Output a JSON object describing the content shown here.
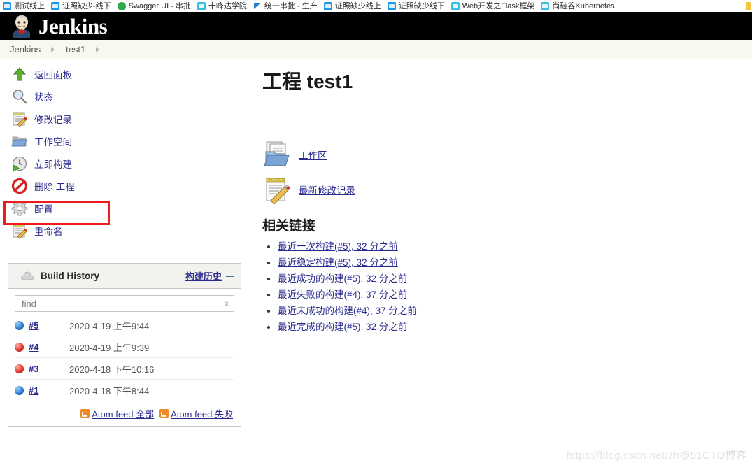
{
  "browser": {
    "bookmarks": [
      {
        "label": "测试线上",
        "icon": "skype-icon",
        "color": "blue"
      },
      {
        "label": "证照缺少-线下",
        "icon": "skype-icon",
        "color": "blue"
      },
      {
        "label": "Swagger UI - 串批",
        "icon": "swagger-icon",
        "color": "green"
      },
      {
        "label": "十峰达学院",
        "icon": "video-icon",
        "color": "cyan"
      },
      {
        "label": "统一串批 - 生产",
        "icon": "flag-icon",
        "color": "navy"
      },
      {
        "label": "证照缺少线上",
        "icon": "skype-icon",
        "color": "blue"
      },
      {
        "label": "证照缺少线下",
        "icon": "skype-icon",
        "color": "blue"
      },
      {
        "label": "Web开发之Flask框架",
        "icon": "video-icon",
        "color": "cyan"
      },
      {
        "label": "尚硅谷Kubernetes",
        "icon": "video-icon",
        "color": "cyan"
      }
    ]
  },
  "header": {
    "title": "Jenkins",
    "logo": "jenkins-butler-logo"
  },
  "breadcrumb": {
    "items": [
      "Jenkins",
      "test1"
    ]
  },
  "sidebar": {
    "items": [
      {
        "label": "返回面板",
        "icon": "up-arrow-icon"
      },
      {
        "label": "状态",
        "icon": "magnifier-icon"
      },
      {
        "label": "修改记录",
        "icon": "notepad-pencil-icon"
      },
      {
        "label": "工作空间",
        "icon": "folder-icon"
      },
      {
        "label": "立即构建",
        "icon": "clock-play-icon"
      },
      {
        "label": "删除 工程",
        "icon": "delete-forbidden-icon"
      },
      {
        "label": "配置",
        "icon": "gear-icon",
        "highlighted": true
      },
      {
        "label": "重命名",
        "icon": "notepad-pencil-icon"
      }
    ],
    "highlight_color": "#ee1c1c"
  },
  "build_history": {
    "title": "Build History",
    "cloud_icon": "weather-cloud-icon",
    "link_label": "构建历史",
    "collapse_icon": "minus-icon",
    "find": {
      "value": "",
      "placeholder": "find",
      "clear_label": "x"
    },
    "rows": [
      {
        "status": "blue",
        "number": "#5",
        "date": "2020-4-19 上午9:44"
      },
      {
        "status": "red",
        "number": "#4",
        "date": "2020-4-19 上午9:39"
      },
      {
        "status": "red",
        "number": "#3",
        "date": "2020-4-18 下午10:16"
      },
      {
        "status": "blue",
        "number": "#1",
        "date": "2020-4-18 下午8:44"
      }
    ],
    "feeds": [
      {
        "label": "Atom feed 全部",
        "icon": "rss-icon"
      },
      {
        "label": "Atom feed 失败",
        "icon": "rss-icon"
      }
    ]
  },
  "main": {
    "title": "工程 test1",
    "quick_links": [
      {
        "label": "工作区",
        "icon": "folder-documents-icon"
      },
      {
        "label": "最新修改记录",
        "icon": "notepad-pencil-icon"
      }
    ],
    "section_title": "相关链接",
    "related_links": [
      {
        "text": "最近一次构建(#5)",
        "suffix": ", 32 分之前"
      },
      {
        "text": "最近稳定构建(#5)",
        "suffix": ", 32 分之前"
      },
      {
        "text": "最近成功的构建(#5)",
        "suffix": ", 32 分之前"
      },
      {
        "text": "最近失败的构建(#4)",
        "suffix": ", 37 分之前"
      },
      {
        "text": "最近未成功的构建(#4)",
        "suffix": ", 37 分之前"
      },
      {
        "text": "最近完成的构建(#5)",
        "suffix": ", 32 分之前"
      }
    ]
  },
  "watermark": {
    "text_left": "https://blog.csdn.net/zh",
    "text_right": "@51CTO博客"
  }
}
